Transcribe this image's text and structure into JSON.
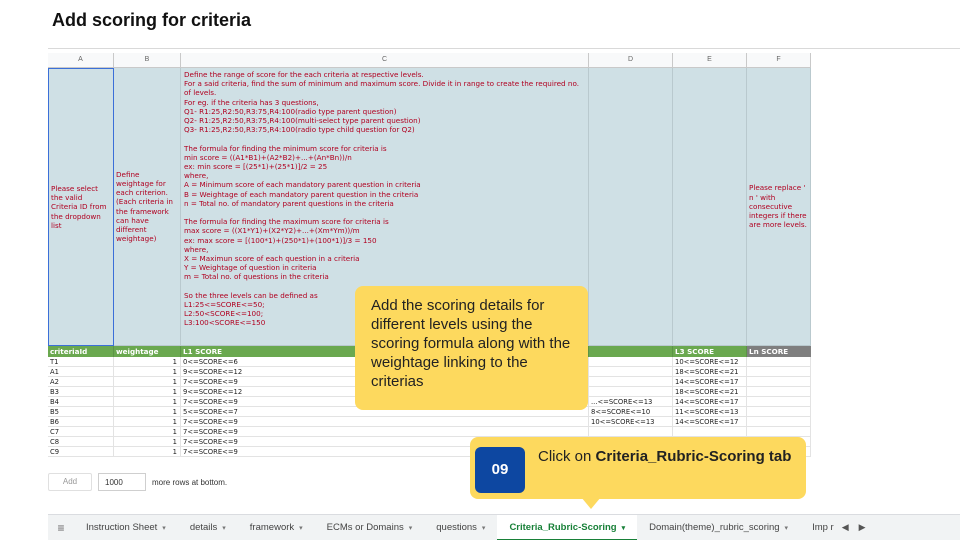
{
  "slide_title": "Add scoring for criteria",
  "columns": [
    "A",
    "B",
    "C",
    "D",
    "E",
    "F"
  ],
  "instruction_row": {
    "a": "Please select the valid Criteria ID from the dropdown list",
    "b": "Define weightage for each criterion. (Each criteria in the framework can have different weightage)",
    "c": "Define the range of score for the each criteria at respective levels.\nFor a said criteria, find the sum of minimum and maximum score. Divide it in range to create the required no. of levels.\nFor eg. if the criteria has 3 questions,\nQ1- R1:25,R2:50,R3:75,R4:100(radio type parent question)\nQ2- R1:25,R2:50,R3:75,R4:100(multi-select type parent question)\nQ3- R1:25,R2:50,R3:75,R4:100(radio type child question for Q2)\n\nThe formula for finding the minimum score for criteria is\nmin score = ((A1*B1)+(A2*B2)+...+(An*Bn))/n\nex: min score = [(25*1)+(25*1)]/2 = 25\nwhere,\nA = Minimum score of each mandatory parent question in criteria\nB = Weightage of each mandatory parent question in the criteria\nn = Total no. of mandatory parent questions in the criteria\n\nThe formula for finding the maximum score for criteria is\nmax score = ((X1*Y1)+(X2*Y2)+...+(Xm*Ym))/m\nex: max score = [(100*1)+(250*1)+(100*1)]/3 = 150\nwhere,\nX = Maximun score of each question in a criteria\nY = Weightage of question in criteria\nm = Total no. of questions in the criteria\n\nSo the three levels can be defined as\nL1:25<=SCORE<=50;\nL2:50<SCORE<=100;\nL3:100<SCORE<=150",
    "f": "Please replace ' n ' with consecutive integers if there are more levels."
  },
  "header_row": [
    "criteriaId",
    "weightage",
    "L1 SCORE",
    "",
    "L3 SCORE",
    "Ln SCORE"
  ],
  "rows": [
    [
      "T1",
      "1",
      "0<=SCORE<=6",
      "",
      "10<=SCORE<=12",
      ""
    ],
    [
      "A1",
      "1",
      "9<=SCORE<=12",
      "",
      "18<=SCORE<=21",
      ""
    ],
    [
      "A2",
      "1",
      "7<=SCORE<=9",
      "",
      "14<=SCORE<=17",
      ""
    ],
    [
      "B3",
      "1",
      "9<=SCORE<=12",
      "",
      "18<=SCORE<=21",
      ""
    ],
    [
      "B4",
      "1",
      "7<=SCORE<=9",
      "...<=SCORE<=13",
      "14<=SCORE<=17",
      ""
    ],
    [
      "B5",
      "1",
      "5<=SCORE<=7",
      "8<=SCORE<=10",
      "11<=SCORE<=13",
      ""
    ],
    [
      "B6",
      "1",
      "7<=SCORE<=9",
      "10<=SCORE<=13",
      "14<=SCORE<=17",
      ""
    ],
    [
      "C7",
      "1",
      "7<=SCORE<=9",
      "",
      "",
      ""
    ],
    [
      "C8",
      "1",
      "7<=SCORE<=9",
      "",
      "",
      ""
    ],
    [
      "C9",
      "1",
      "7<=SCORE<=9",
      "",
      "",
      ""
    ]
  ],
  "add_rows": {
    "button": "Add",
    "count": "1000",
    "suffix": "more rows at bottom."
  },
  "tabs": [
    "Instruction Sheet",
    "details",
    "framework",
    "ECMs or Domains",
    "questions",
    "Criteria_Rubric-Scoring",
    "Domain(theme)_rubric_scoring",
    "Imp r"
  ],
  "active_tab": "Criteria_Rubric-Scoring",
  "callout_text": "Add the scoring details for different levels using the scoring formula along with the weightage linking to the criterias",
  "step": {
    "number": "09",
    "prefix": "Click on ",
    "target": "Criteria_Rubric-Scoring",
    "suffix": " tab"
  },
  "colors": {
    "accent_yellow": "#fdd95e",
    "step_blue": "#0d47a1",
    "header_green": "#6aa84f",
    "active_tab_green": "#188038",
    "instruction_red": "#b00020"
  }
}
